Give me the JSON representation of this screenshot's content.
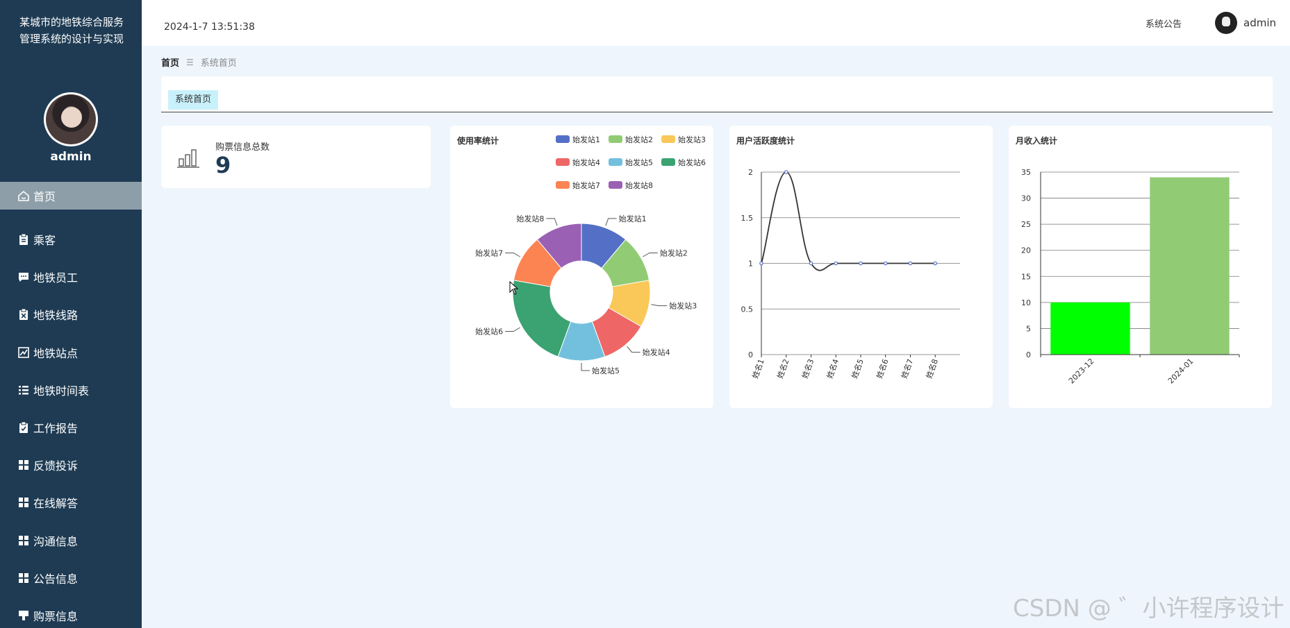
{
  "app": {
    "title": "某城市的地铁综合服务管理系统的设计与实现"
  },
  "sidebar": {
    "username": "admin",
    "items": [
      {
        "label": "首页",
        "icon": "home-icon",
        "active": true
      },
      {
        "label": "乘客",
        "icon": "clipboard-icon"
      },
      {
        "label": "地铁员工",
        "icon": "chat-icon"
      },
      {
        "label": "地铁线路",
        "icon": "clipboard-x-icon"
      },
      {
        "label": "地铁站点",
        "icon": "chart-line-icon"
      },
      {
        "label": "地铁时间表",
        "icon": "list-icon"
      },
      {
        "label": "工作报告",
        "icon": "clipboard-check-icon"
      },
      {
        "label": "反馈投诉",
        "icon": "grid-icon"
      },
      {
        "label": "在线解答",
        "icon": "grid-icon"
      },
      {
        "label": "沟通信息",
        "icon": "grid-icon"
      },
      {
        "label": "公告信息",
        "icon": "grid-icon"
      },
      {
        "label": "购票信息",
        "icon": "ticket-icon"
      }
    ]
  },
  "topbar": {
    "datetime": "2024-1-7 13:51:38",
    "notice": "系统公告",
    "username": "admin"
  },
  "breadcrumb": {
    "home": "首页",
    "separator": "☰",
    "current": "系统首页"
  },
  "tabs": [
    {
      "label": "系统首页"
    }
  ],
  "stat": {
    "label": "购票信息总数",
    "value": "9"
  },
  "colors": {
    "sidebar": "#1e3b53",
    "page_bg": "#eef5fd",
    "tab_bg": "#c8f1fb",
    "pie": [
      "#5470c6",
      "#91cc75",
      "#fac858",
      "#ee6666",
      "#73c0de",
      "#3ba272",
      "#fc8452",
      "#9a60b4"
    ],
    "bar": [
      "#00ff00",
      "#91cc75"
    ]
  },
  "chart_data": [
    {
      "type": "pie",
      "title": "使用率统计",
      "categories": [
        "始发站1",
        "始发站2",
        "始发站3",
        "始发站4",
        "始发站5",
        "始发站6",
        "始发站7",
        "始发站8"
      ],
      "values": [
        1,
        1,
        1,
        1,
        1,
        2,
        1,
        1
      ],
      "donut": true,
      "legend": "top-right"
    },
    {
      "type": "line",
      "title": "用户活跃度统计",
      "categories": [
        "姓名1",
        "姓名2",
        "姓名3",
        "姓名4",
        "姓名5",
        "姓名6",
        "姓名7",
        "姓名8"
      ],
      "values": [
        1,
        2,
        1,
        1,
        1,
        1,
        1,
        1
      ],
      "smooth": true,
      "ylim": [
        0,
        2
      ],
      "yticks": [
        "0",
        "0.5",
        "1",
        "1.5",
        "2"
      ],
      "grid": true
    },
    {
      "type": "bar",
      "title": "月收入统计",
      "categories": [
        "2023-12",
        "2024-01"
      ],
      "values": [
        10,
        34
      ],
      "ylim": [
        0,
        35
      ],
      "yticks": [
        "0",
        "5",
        "10",
        "15",
        "20",
        "25",
        "30",
        "35"
      ],
      "grid": true
    }
  ],
  "watermark": "CSDN @ ゛小许程序设计"
}
